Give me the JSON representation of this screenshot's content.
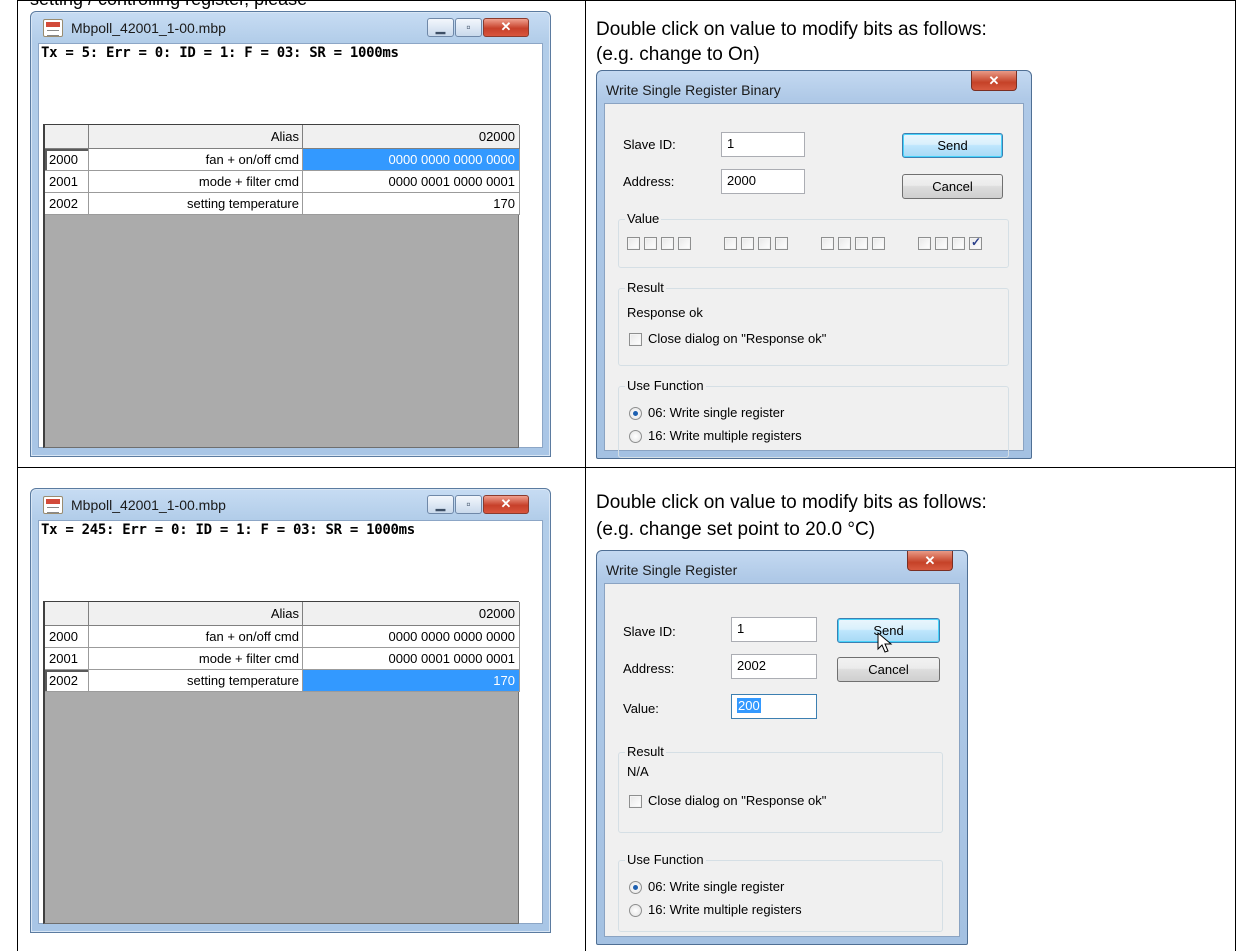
{
  "header_fragment": "setting / controlling register, please",
  "rows": [
    {
      "caption_lines": [
        "Double click on value to modify bits as follows:",
        "(e.g. change to On)"
      ],
      "window": {
        "title": "Mbpoll_42001_1-00.mbp",
        "status": "Tx = 5: Err = 0: ID = 1: F = 03: SR = 1000ms",
        "col_alias": "Alias",
        "col_value": "02000",
        "registers": [
          {
            "addr": "2000",
            "alias": "fan + on/off cmd",
            "value": "0000 0000 0000 0000"
          },
          {
            "addr": "2001",
            "alias": "mode + filter cmd",
            "value": "0000 0001 0000 0001"
          },
          {
            "addr": "2002",
            "alias": "setting temperature",
            "value": "170"
          }
        ]
      },
      "dialog": {
        "title": "Write Single Register Binary",
        "slave_id_label": "Slave ID:",
        "slave_id": "1",
        "address_label": "Address:",
        "address": "2000",
        "send": "Send",
        "cancel": "Cancel",
        "value_group": "Value",
        "bits": [
          0,
          0,
          0,
          0,
          0,
          0,
          0,
          0,
          0,
          0,
          0,
          0,
          0,
          0,
          0,
          1
        ],
        "result_group": "Result",
        "result_text": "Response ok",
        "close_on_ok": "Close dialog on \"Response ok\"",
        "use_function_group": "Use Function",
        "fn06": "06: Write single register",
        "fn16": "16: Write multiple registers"
      }
    },
    {
      "caption_lines": [
        "Double click on value to modify bits as follows:",
        "(e.g. change set point to 20.0 °C)"
      ],
      "window": {
        "title": "Mbpoll_42001_1-00.mbp",
        "status": "Tx = 245: Err = 0: ID = 1: F = 03: SR = 1000ms",
        "col_alias": "Alias",
        "col_value": "02000",
        "registers": [
          {
            "addr": "2000",
            "alias": "fan + on/off cmd",
            "value": "0000 0000 0000 0000"
          },
          {
            "addr": "2001",
            "alias": "mode + filter cmd",
            "value": "0000 0001 0000 0001"
          },
          {
            "addr": "2002",
            "alias": "setting temperature",
            "value": "170"
          }
        ]
      },
      "dialog": {
        "title": "Write Single Register",
        "slave_id_label": "Slave ID:",
        "slave_id": "1",
        "address_label": "Address:",
        "address": "2002",
        "value_label": "Value:",
        "value": "200",
        "send": "Send",
        "cancel": "Cancel",
        "result_group": "Result",
        "result_text": "N/A",
        "close_on_ok": "Close dialog on \"Response ok\"",
        "use_function_group": "Use Function",
        "fn06": "06: Write single register",
        "fn16": "16: Write multiple registers"
      }
    }
  ]
}
